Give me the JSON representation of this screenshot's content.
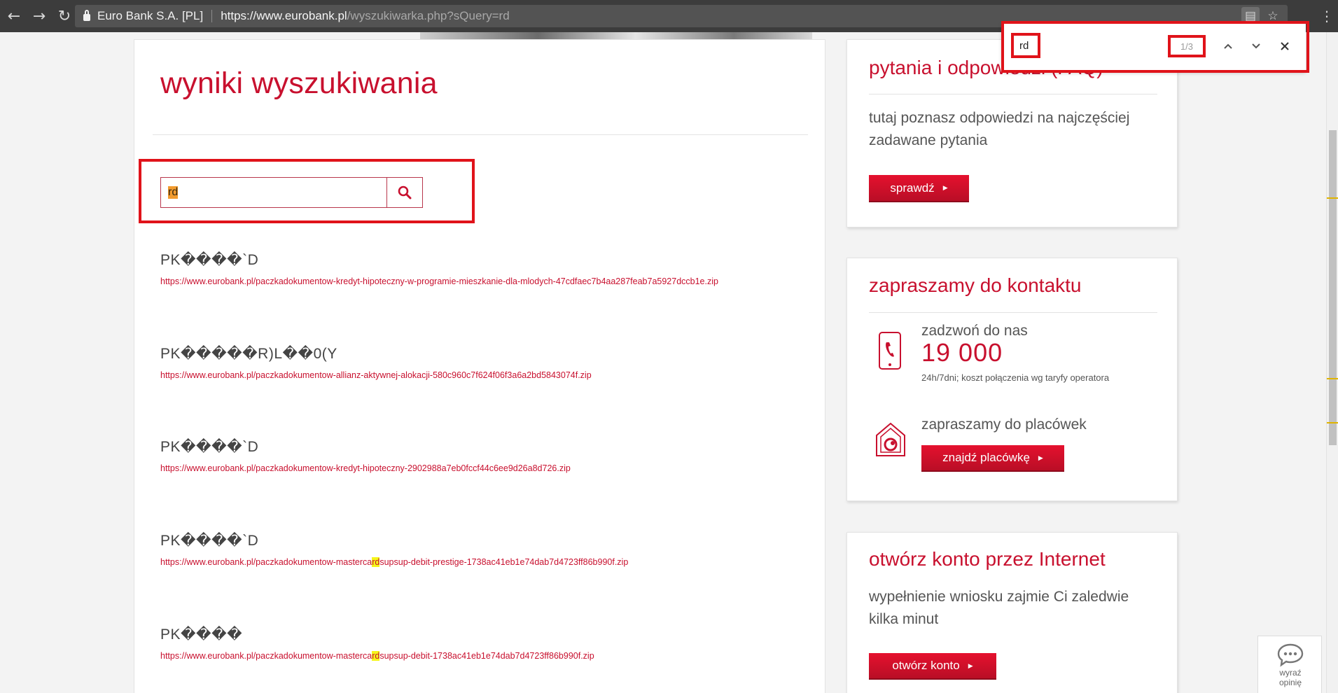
{
  "browser": {
    "tab_title": "Euro Bank S.A. [PL]",
    "url_host": "https://www.eurobank.pl",
    "url_path": "/wyszukiwarka.php?sQuery=rd",
    "icons": [
      "back-icon",
      "forward-icon",
      "reload-icon",
      "lock-icon",
      "find-in-page-icon",
      "star-icon",
      "menu-icon"
    ]
  },
  "find_bar": {
    "query": "rd",
    "match_count": "1/3"
  },
  "main": {
    "title": "wyniki wyszukiwania",
    "search": {
      "value": "rd"
    },
    "results": [
      {
        "title": "PK����`D",
        "url_before": "https://www.eurobank.pl/paczkadokumentow-kredyt-hipoteczny-w-programie-mieszkanie-dla-mlodych-47cdfaec7b4aa287feab7a5927dccb1e.zip",
        "url_match": "",
        "url_after": ""
      },
      {
        "title": "PK�����R)L��0(Y",
        "url_before": "https://www.eurobank.pl/paczkadokumentow-allianz-aktywnej-alokacji-580c960c7f624f06f3a6a2bd5843074f.zip",
        "url_match": "",
        "url_after": ""
      },
      {
        "title": "PK����`D",
        "url_before": "https://www.eurobank.pl/paczkadokumentow-kredyt-hipoteczny-2902988a7eb0fccf44c6ee9d26a8d726.zip",
        "url_match": "",
        "url_after": ""
      },
      {
        "title": "PK����`D",
        "url_before": "https://www.eurobank.pl/paczkadokumentow-masterca",
        "url_match": "rd",
        "url_after": "supsup-debit-prestige-1738ac41eb1e74dab7d4723ff86b990f.zip"
      },
      {
        "title": "PK����",
        "url_before": "https://www.eurobank.pl/paczkadokumentow-masterca",
        "url_match": "rd",
        "url_after": "supsup-debit-1738ac41eb1e74dab7d4723ff86b990f.zip"
      }
    ]
  },
  "sidebar": {
    "faq": {
      "title": "pytania i odpowiedzi (FAQ)",
      "text": "tutaj poznasz odpowiedzi na najczęściej zadawane pytania",
      "button": "sprawdź"
    },
    "contact": {
      "title": "zapraszamy do kontaktu",
      "call_label": "zadzwoń do nas",
      "phone": "19 000",
      "note": "24h/7dni; koszt połączenia wg taryfy operatora",
      "branches_label": "zapraszamy do placówek",
      "branches_button": "znajdź placówkę"
    },
    "account": {
      "title": "otwórz konto przez Internet",
      "text": "wypełnienie wniosku zajmie Ci zaledwie kilka minut",
      "button": "otwórz konto"
    }
  },
  "feedback": {
    "label_line1": "wyraź",
    "label_line2": "opinię"
  },
  "colors": {
    "brand_red": "#c8102e",
    "annotation_red": "#e0131a",
    "match_highlight": "#f5f51a",
    "active_match": "#f29b2e"
  }
}
